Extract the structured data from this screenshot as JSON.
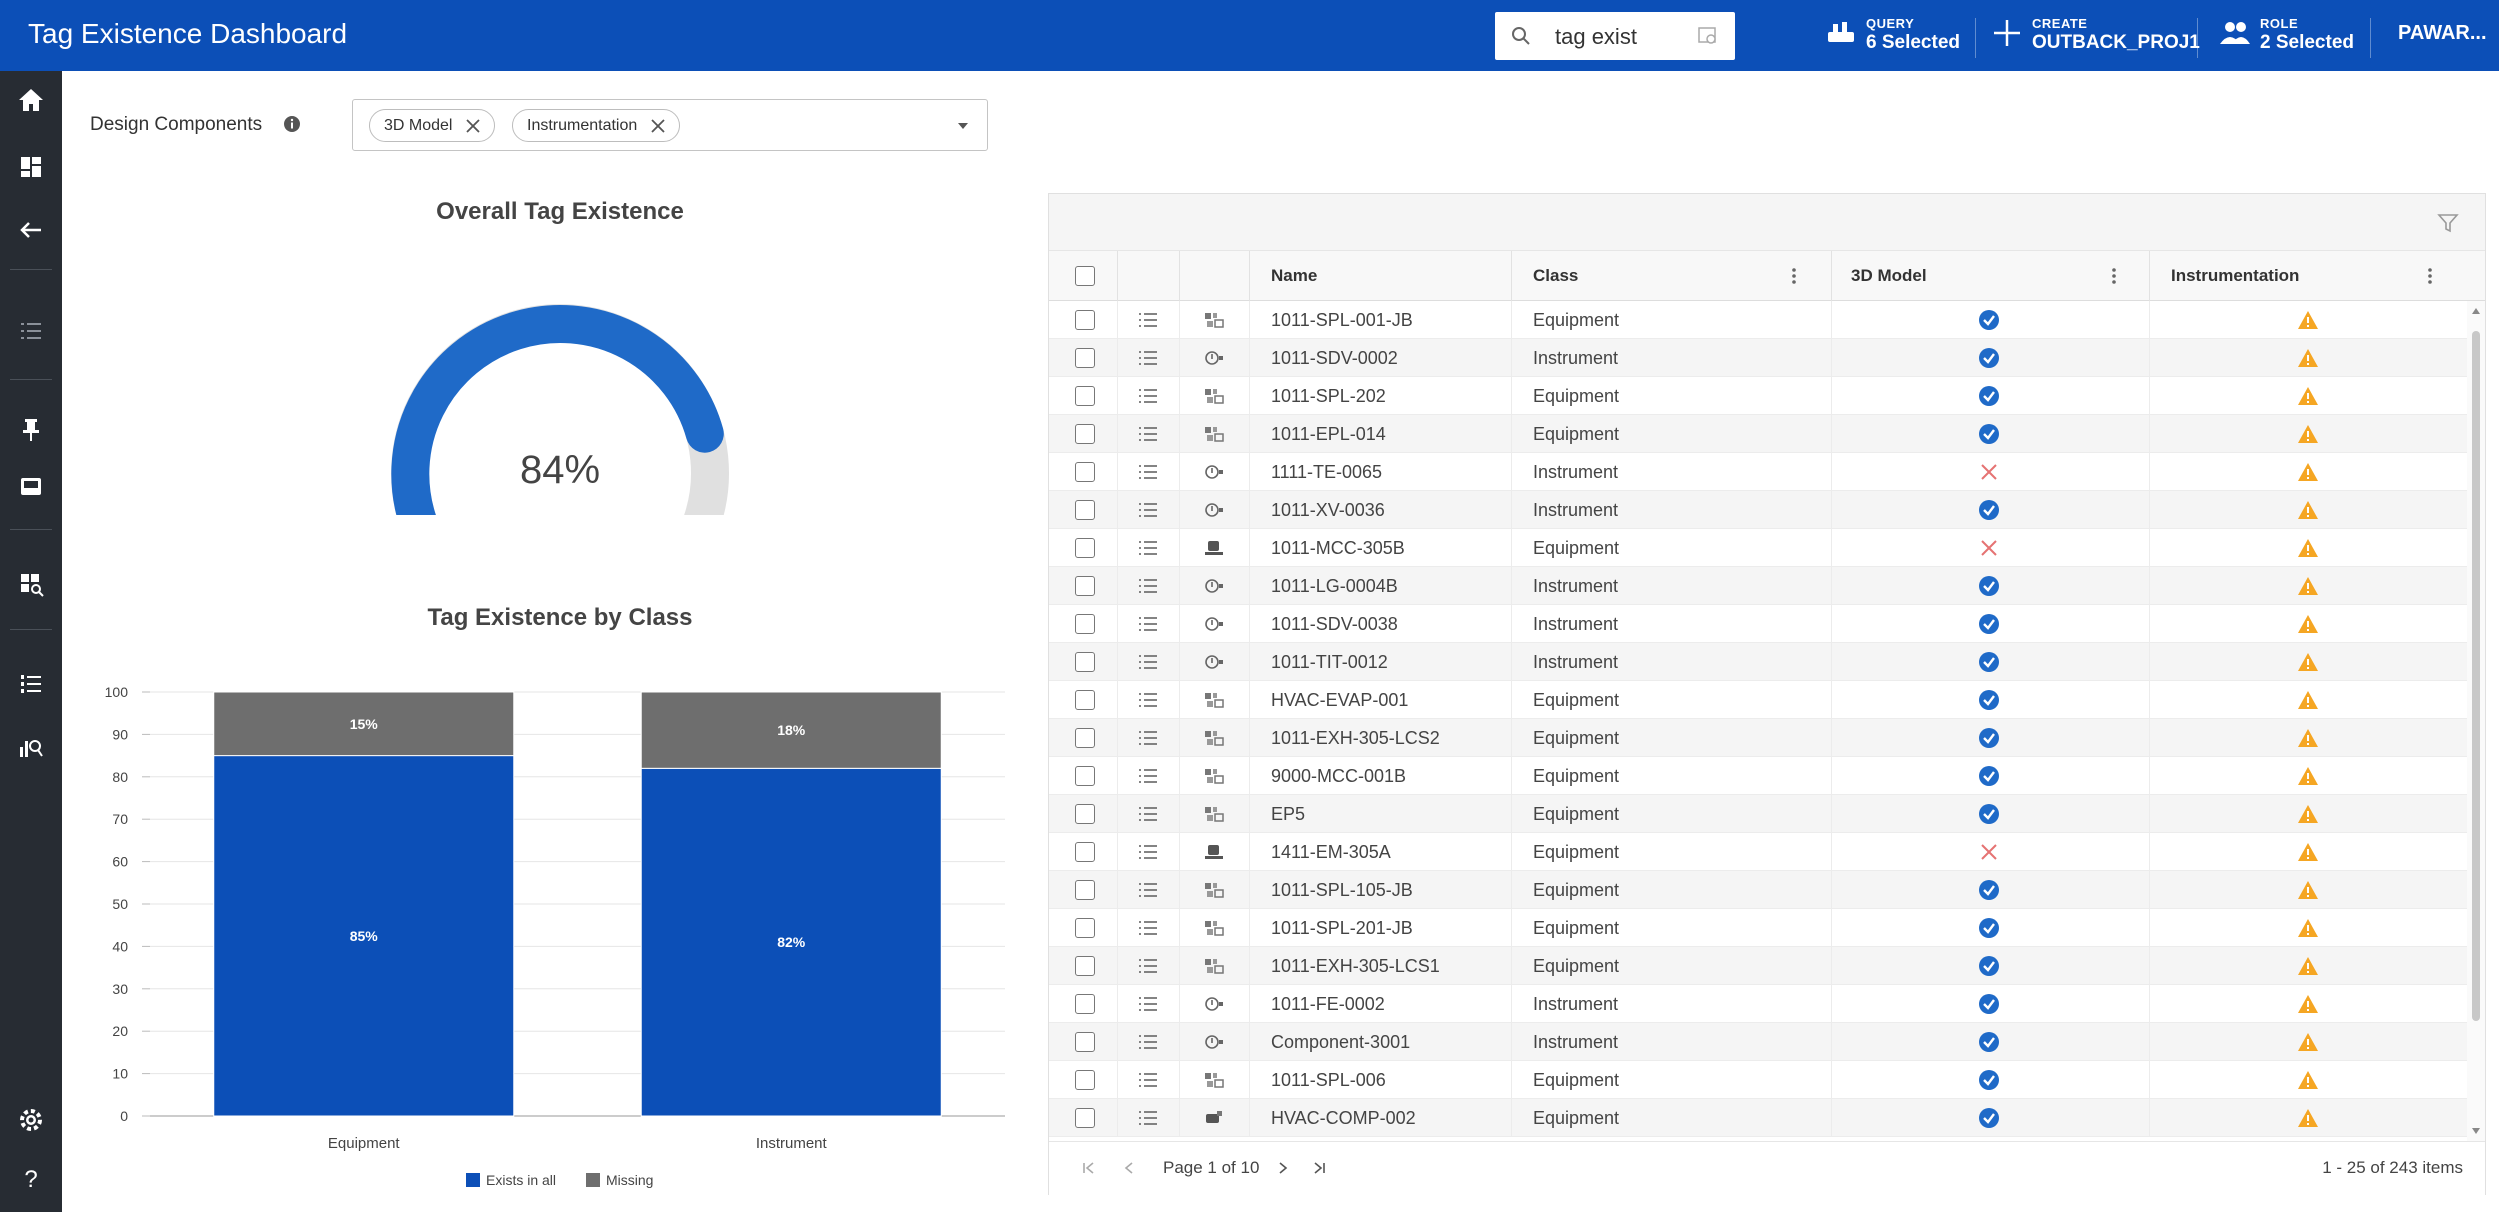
{
  "header": {
    "title": "Tag Existence Dashboard",
    "search_value": "tag exist",
    "query": {
      "small": "QUERY",
      "big": "6 Selected"
    },
    "create": {
      "small": "CREATE",
      "big": "OUTBACK_PROJ1"
    },
    "role": {
      "small": "ROLE",
      "big": "2 Selected"
    },
    "user": "PAWAR..."
  },
  "sidebar": {
    "icons": [
      "home-icon",
      "dashboard-icon",
      "back-arrow-icon",
      "list-icon",
      "pin-icon",
      "inbox-icon",
      "report-icon",
      "numbered-list-icon",
      "analytics-icon",
      "settings-icon",
      "help-icon"
    ]
  },
  "filter": {
    "label": "Design Components",
    "chips": [
      "3D Model",
      "Instrumentation"
    ]
  },
  "gauge": {
    "title": "Overall Tag Existence",
    "value_label": "84%",
    "value": 84,
    "color": "#1f6ac8",
    "track_color": "#e0e0e0"
  },
  "chart_data": {
    "type": "bar",
    "stacked": true,
    "title": "Tag Existence by Class",
    "categories": [
      "Equipment",
      "Instrument"
    ],
    "series": [
      {
        "name": "Exists in all",
        "values": [
          85,
          82
        ],
        "labels": [
          "85%",
          "82%"
        ],
        "color": "#0c4fb7"
      },
      {
        "name": "Missing",
        "values": [
          15,
          18
        ],
        "labels": [
          "15%",
          "18%"
        ],
        "color": "#6e6e6e"
      }
    ],
    "ylim": [
      0,
      100
    ],
    "yticks": [
      0,
      10,
      20,
      30,
      40,
      50,
      60,
      70,
      80,
      90,
      100
    ],
    "grid": true,
    "legend_position": "bottom"
  },
  "grid": {
    "columns": {
      "name": "Name",
      "class": "Class",
      "model": "3D Model",
      "instr": "Instrumentation"
    },
    "rows": [
      {
        "name": "1011-SPL-001-JB",
        "class": "Equipment",
        "type_icon": "equipment-icon",
        "model": "check",
        "instr": "warning"
      },
      {
        "name": "1011-SDV-0002",
        "class": "Instrument",
        "type_icon": "instrument-icon",
        "model": "check",
        "instr": "warning"
      },
      {
        "name": "1011-SPL-202",
        "class": "Equipment",
        "type_icon": "equipment-icon",
        "model": "check",
        "instr": "warning"
      },
      {
        "name": "1011-EPL-014",
        "class": "Equipment",
        "type_icon": "equipment-icon",
        "model": "check",
        "instr": "warning"
      },
      {
        "name": "1111-TE-0065",
        "class": "Instrument",
        "type_icon": "instrument-icon",
        "model": "missing",
        "instr": "warning"
      },
      {
        "name": "1011-XV-0036",
        "class": "Instrument",
        "type_icon": "instrument-icon",
        "model": "check",
        "instr": "warning"
      },
      {
        "name": "1011-MCC-305B",
        "class": "Equipment",
        "type_icon": "motor-icon",
        "model": "missing",
        "instr": "warning"
      },
      {
        "name": "1011-LG-0004B",
        "class": "Instrument",
        "type_icon": "instrument-icon",
        "model": "check",
        "instr": "warning"
      },
      {
        "name": "1011-SDV-0038",
        "class": "Instrument",
        "type_icon": "instrument-icon",
        "model": "check",
        "instr": "warning"
      },
      {
        "name": "1011-TIT-0012",
        "class": "Instrument",
        "type_icon": "instrument-icon",
        "model": "check",
        "instr": "warning"
      },
      {
        "name": "HVAC-EVAP-001",
        "class": "Equipment",
        "type_icon": "equipment-icon",
        "model": "check",
        "instr": "warning"
      },
      {
        "name": "1011-EXH-305-LCS2",
        "class": "Equipment",
        "type_icon": "equipment-icon",
        "model": "check",
        "instr": "warning"
      },
      {
        "name": "9000-MCC-001B",
        "class": "Equipment",
        "type_icon": "equipment-icon",
        "model": "check",
        "instr": "warning"
      },
      {
        "name": "EP5",
        "class": "Equipment",
        "type_icon": "equipment-icon",
        "model": "check",
        "instr": "warning"
      },
      {
        "name": "1411-EM-305A",
        "class": "Equipment",
        "type_icon": "motor-icon",
        "model": "missing",
        "instr": "warning"
      },
      {
        "name": "1011-SPL-105-JB",
        "class": "Equipment",
        "type_icon": "equipment-icon",
        "model": "check",
        "instr": "warning"
      },
      {
        "name": "1011-SPL-201-JB",
        "class": "Equipment",
        "type_icon": "equipment-icon",
        "model": "check",
        "instr": "warning"
      },
      {
        "name": "1011-EXH-305-LCS1",
        "class": "Equipment",
        "type_icon": "equipment-icon",
        "model": "check",
        "instr": "warning"
      },
      {
        "name": "1011-FE-0002",
        "class": "Instrument",
        "type_icon": "instrument-icon",
        "model": "check",
        "instr": "warning"
      },
      {
        "name": "Component-3001",
        "class": "Instrument",
        "type_icon": "instrument-icon",
        "model": "check",
        "instr": "warning"
      },
      {
        "name": "1011-SPL-006",
        "class": "Equipment",
        "type_icon": "equipment-icon",
        "model": "check",
        "instr": "warning"
      },
      {
        "name": "HVAC-COMP-002",
        "class": "Equipment",
        "type_icon": "compressor-icon",
        "model": "check",
        "instr": "warning"
      }
    ],
    "pagination": {
      "page_label": "Page 1 of 10",
      "count_label": "1 - 25 of 243 items"
    }
  },
  "colors": {
    "brand": "#0c4fb7",
    "sidebar": "#272c33",
    "check": "#1f6ac8",
    "warning": "#f5a623",
    "missing": "#e57373"
  }
}
